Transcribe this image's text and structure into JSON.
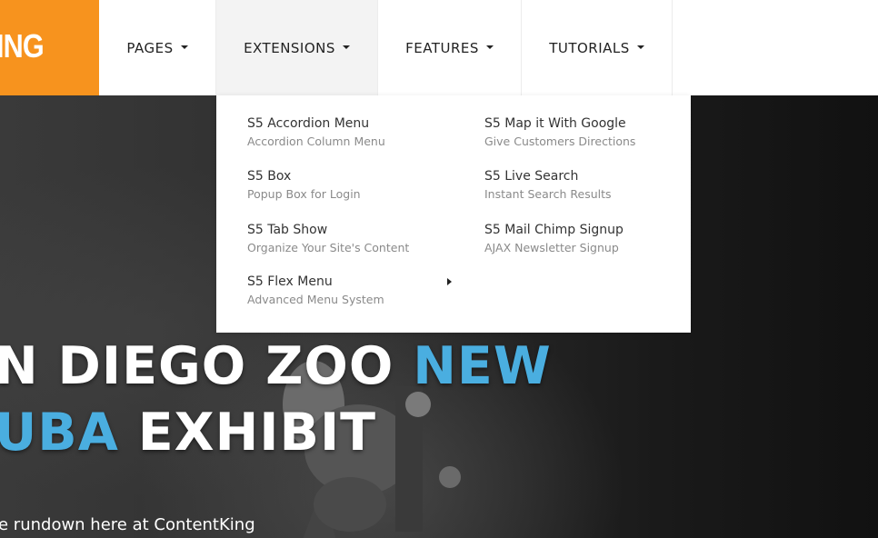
{
  "logo": {
    "text": "ING"
  },
  "nav": {
    "items": [
      {
        "label": "PAGES"
      },
      {
        "label": "EXTENSIONS"
      },
      {
        "label": "FEATURES"
      },
      {
        "label": "TUTORIALS"
      }
    ]
  },
  "dropdown": {
    "left": [
      {
        "title": "S5 Accordion Menu",
        "desc": "Accordion Column Menu"
      },
      {
        "title": "S5 Box",
        "desc": "Popup Box for Login"
      },
      {
        "title": "S5 Tab Show",
        "desc": "Organize Your Site's Content"
      },
      {
        "title": "S5 Flex Menu",
        "desc": "Advanced Menu System"
      }
    ],
    "right": [
      {
        "title": "S5 Map it With Google",
        "desc": "Give Customers Directions"
      },
      {
        "title": "S5 Live Search",
        "desc": "Instant Search Results"
      },
      {
        "title": "S5 Mail Chimp Signup",
        "desc": "AJAX Newsletter Signup"
      }
    ]
  },
  "hero": {
    "line1_a": "N DIEGO ZOO ",
    "line1_b": "NEW",
    "line2_a": "UBA",
    "line2_b": " EXHIBIT",
    "subtitle": "e rundown here at ContentKing"
  },
  "colors": {
    "brand": "#f7931e",
    "accent": "#4aaee0"
  },
  "icons": {
    "caret": "caret-down-icon",
    "submenu": "caret-right-icon"
  }
}
